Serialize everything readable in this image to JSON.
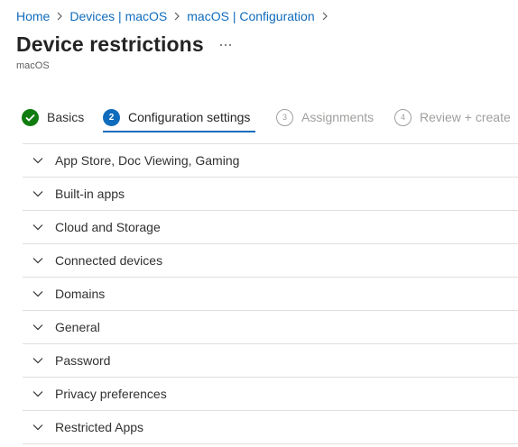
{
  "breadcrumb": {
    "items": [
      {
        "label": "Home"
      },
      {
        "label": "Devices | macOS"
      },
      {
        "label": "macOS | Configuration"
      }
    ]
  },
  "header": {
    "title": "Device restrictions",
    "more_label": "...",
    "subtitle": "macOS"
  },
  "wizard": {
    "steps": [
      {
        "number": "",
        "label": "Basics",
        "state": "completed"
      },
      {
        "number": "2",
        "label": "Configuration settings",
        "state": "current"
      },
      {
        "number": "3",
        "label": "Assignments",
        "state": "pending"
      },
      {
        "number": "4",
        "label": "Review + create",
        "state": "pending"
      }
    ]
  },
  "sections": [
    {
      "label": "App Store, Doc Viewing, Gaming"
    },
    {
      "label": "Built-in apps"
    },
    {
      "label": "Cloud and Storage"
    },
    {
      "label": "Connected devices"
    },
    {
      "label": "Domains"
    },
    {
      "label": "General"
    },
    {
      "label": "Password"
    },
    {
      "label": "Privacy preferences"
    },
    {
      "label": "Restricted Apps"
    }
  ],
  "colors": {
    "link": "#0f6cbd",
    "success": "#107c10",
    "accent": "#0f6cbd",
    "disabled": "#a19f9d"
  }
}
